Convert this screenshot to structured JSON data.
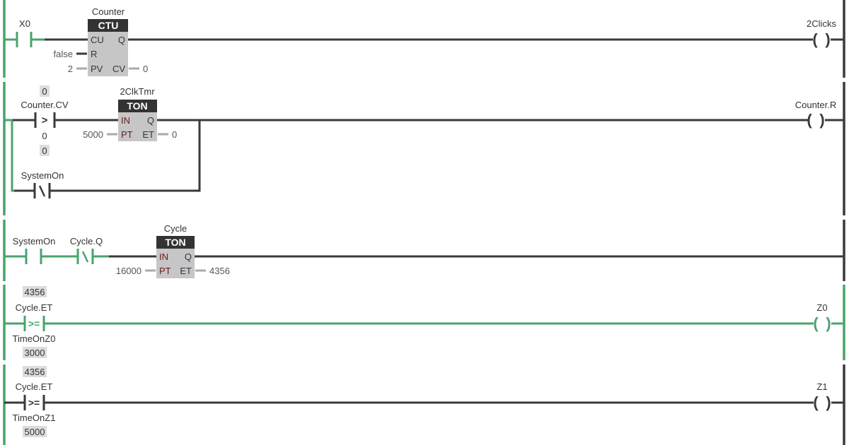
{
  "colors": {
    "energized": "#4aa36c",
    "deenergized": "#3a3a3a",
    "block_body": "#c6c6c6",
    "block_header": "#333333"
  },
  "rungs": [
    {
      "energized_rail": true,
      "contact": {
        "name": "X0",
        "type": "NO",
        "energized": true
      },
      "block": {
        "instance": "Counter",
        "type": "CTU",
        "inputs": [
          "CU",
          "R",
          "PV"
        ],
        "outputs": [
          "Q",
          "CV"
        ],
        "r_value": "false",
        "pv_value": "2",
        "cv_value": "0"
      },
      "coil": {
        "name": "2Clicks",
        "energized": false
      }
    },
    {
      "compare": {
        "op": ">",
        "left": "Counter.CV",
        "left_value": "0",
        "right": "0",
        "right_value": "0"
      },
      "branch_contact": {
        "name": "SystemOn",
        "type": "NC"
      },
      "block": {
        "instance": "2ClkTmr",
        "type": "TON",
        "inputs": [
          "IN",
          "PT"
        ],
        "outputs": [
          "Q",
          "ET"
        ],
        "pt_value": "5000",
        "et_value": "0"
      },
      "coil": {
        "name": "Counter.R",
        "energized": false
      }
    },
    {
      "contacts": [
        {
          "name": "SystemOn",
          "type": "NO",
          "energized": true
        },
        {
          "name": "Cycle.Q",
          "type": "NC",
          "energized": true
        }
      ],
      "block": {
        "instance": "Cycle",
        "type": "TON",
        "inputs": [
          "IN",
          "PT"
        ],
        "outputs": [
          "Q",
          "ET"
        ],
        "pt_value": "16000",
        "et_value": "4356"
      }
    },
    {
      "compare": {
        "op": ">=",
        "left": "Cycle.ET",
        "left_value": "4356",
        "right": "TimeOnZ0",
        "right_value": "3000",
        "energized": true
      },
      "coil": {
        "name": "Z0",
        "energized": true
      }
    },
    {
      "compare": {
        "op": ">=",
        "left": "Cycle.ET",
        "left_value": "4356",
        "right": "TimeOnZ1",
        "right_value": "5000",
        "energized": false
      },
      "coil": {
        "name": "Z1",
        "energized": false
      }
    }
  ]
}
